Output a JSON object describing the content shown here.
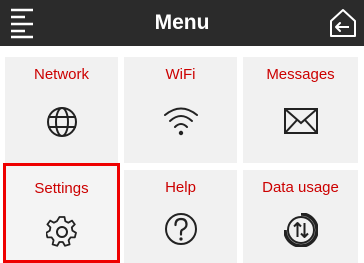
{
  "header": {
    "title": "Menu",
    "menu_icon": "hamburger-menu-icon",
    "home_icon": "home-back-icon"
  },
  "tiles": [
    {
      "label": "Network",
      "icon": "globe-icon"
    },
    {
      "label": "WiFi",
      "icon": "wifi-icon"
    },
    {
      "label": "Messages",
      "icon": "envelope-icon"
    },
    {
      "label": "Settings",
      "icon": "gear-icon",
      "selected": true
    },
    {
      "label": "Help",
      "icon": "question-circle-icon"
    },
    {
      "label": "Data usage",
      "icon": "data-usage-icon"
    }
  ],
  "colors": {
    "header_bg": "#2b2b2b",
    "label": "#cc0000",
    "selection": "#ee0000",
    "tile_bg": "#f1f1f1"
  }
}
